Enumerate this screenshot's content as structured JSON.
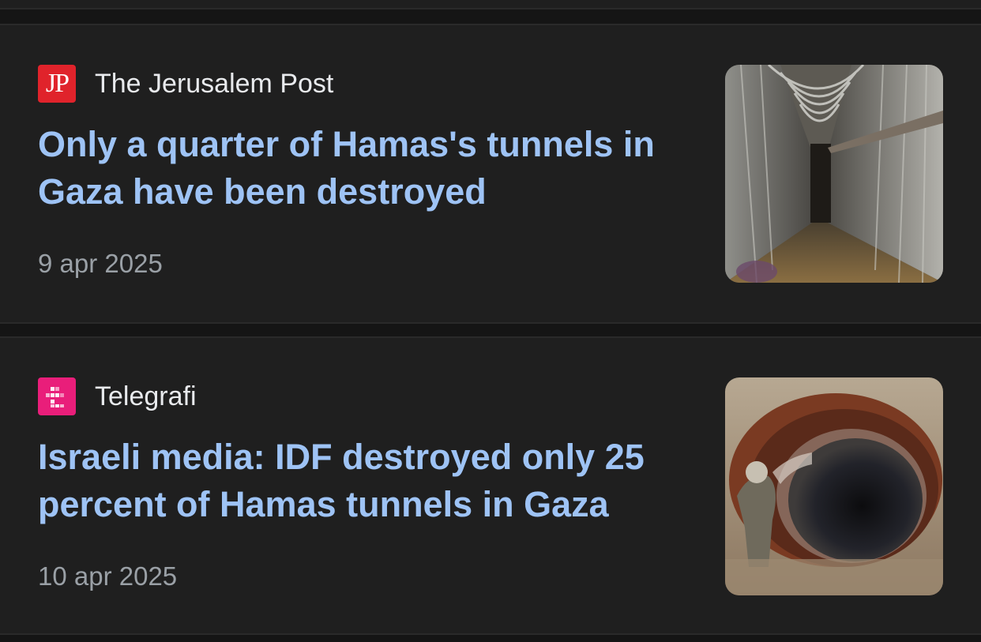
{
  "articles": [
    {
      "source": "The Jerusalem Post",
      "logo_icon": "jerusalem-post-logo",
      "logo_text": "JP",
      "logo_color": "#e0232b",
      "headline": "Only a quarter of Hamas's tunnels in Gaza have been destroyed",
      "date": "9 apr 2025",
      "thumbnail_icon": "tunnel-corridor-photo"
    },
    {
      "source": "Telegrafi",
      "logo_icon": "telegrafi-logo",
      "logo_color": "#e91e7a",
      "headline": "Israeli media: IDF destroyed only 25 percent of Hamas tunnels in Gaza",
      "date": "10 apr 2025",
      "thumbnail_icon": "tunnel-pipe-photo"
    }
  ],
  "colors": {
    "background": "#1f1f1f",
    "headline": "#9ec3f5",
    "source": "#e8eaed",
    "date": "#9aa0a6"
  }
}
